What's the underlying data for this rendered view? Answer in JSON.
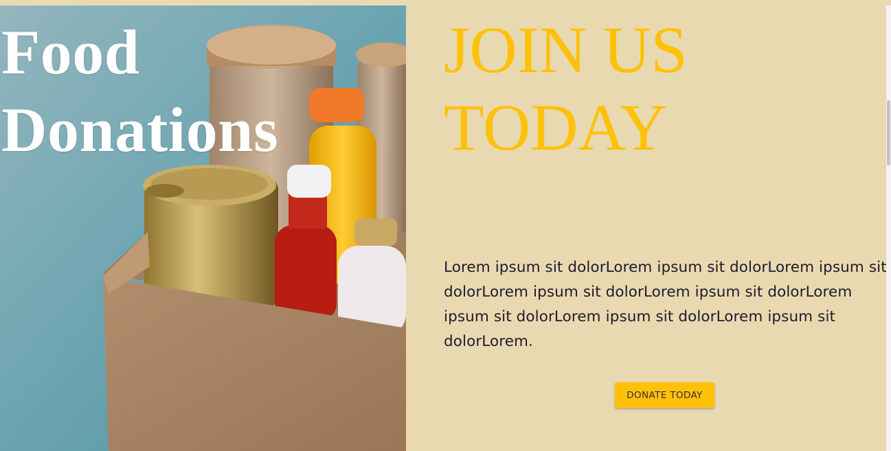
{
  "hero": {
    "title_line1": "Food",
    "title_line2": "Donations",
    "image": "food-donation-box-photo"
  },
  "panel": {
    "heading_line1": "JOIN US",
    "heading_line2": "TODAY",
    "body": "Lorem ipsum sit dolorLorem ipsum sit dolorLorem ipsum sit dolorLorem ipsum sit dolorLorem ipsum sit dolorLorem ipsum sit dolorLorem ipsum sit dolorLorem ipsum sit dolorLorem.",
    "button_label": "DONATE TODAY"
  },
  "colors": {
    "panel_bg": "#e8d9b0",
    "accent": "#ffc107",
    "text": "#1f1a2e"
  }
}
